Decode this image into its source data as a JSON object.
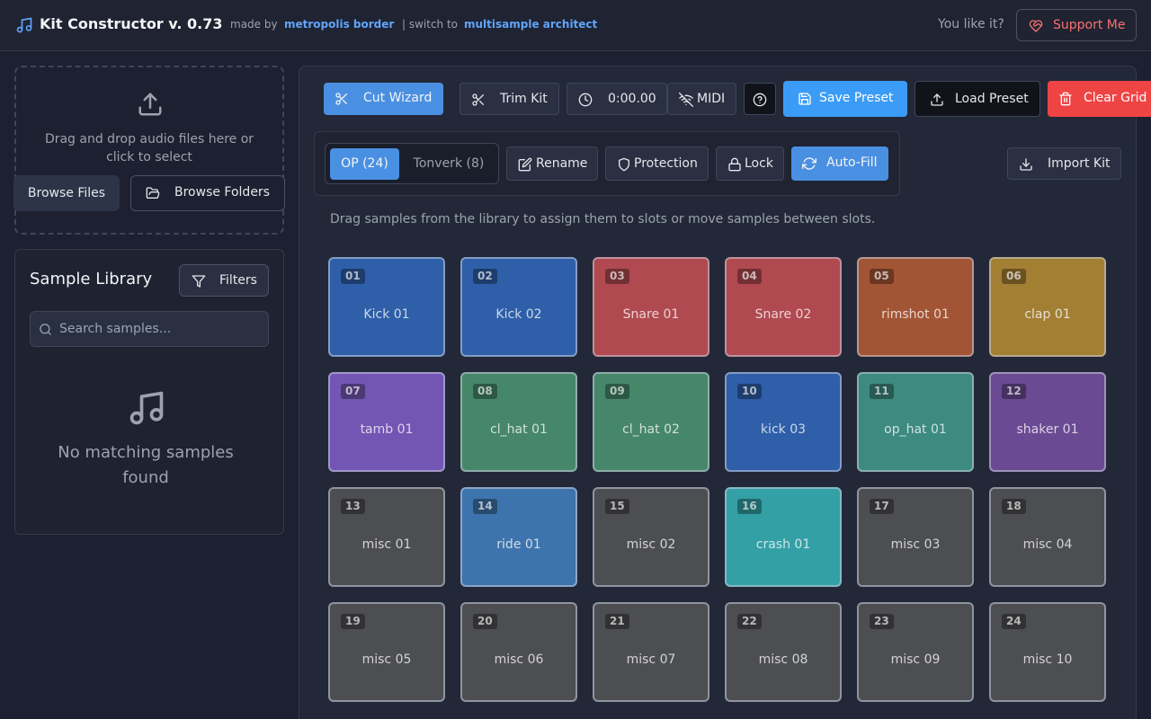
{
  "header": {
    "title": "Kit Constructor v. 0.73",
    "made_by": "made by",
    "author": "metropolis border",
    "switch_to": "| switch to",
    "switch_link": "multisample architect",
    "you_like": "You like it?",
    "support_label": "Support Me"
  },
  "upload": {
    "text": "Drag and drop audio files here or click to select",
    "browse_files": "Browse Files",
    "browse_folders": "Browse Folders"
  },
  "library": {
    "title": "Sample Library",
    "filters_label": "Filters",
    "search_placeholder": "Search samples...",
    "empty_text": "No matching samples found"
  },
  "toolbar": {
    "cut_wizard": "Cut Wizard",
    "trim_kit": "Trim Kit",
    "time": "0:00.00",
    "midi": "MIDI",
    "save_preset": "Save Preset",
    "load_preset": "Load Preset",
    "clear_grid": "Clear Grid"
  },
  "tools": {
    "tab_op": "OP (24)",
    "tab_tonverk": "Tonverk (8)",
    "rename": "Rename",
    "protection": "Protection",
    "lock": "Lock",
    "auto_fill": "Auto-Fill",
    "import_kit": "Import Kit"
  },
  "hint": "Drag samples from the library to assign them to slots or move samples between slots.",
  "pads": [
    {
      "num": "01",
      "name": "Kick 01",
      "color": "#2e5fa8"
    },
    {
      "num": "02",
      "name": "Kick 02",
      "color": "#2e5fa8"
    },
    {
      "num": "03",
      "name": "Snare 01",
      "color": "#b04a50"
    },
    {
      "num": "04",
      "name": "Snare 02",
      "color": "#b04a50"
    },
    {
      "num": "05",
      "name": "rimshot 01",
      "color": "#a25535"
    },
    {
      "num": "06",
      "name": "clap 01",
      "color": "#a37f34"
    },
    {
      "num": "07",
      "name": "tamb 01",
      "color": "#7356b3"
    },
    {
      "num": "08",
      "name": "cl_hat 01",
      "color": "#46876a"
    },
    {
      "num": "09",
      "name": "cl_hat 02",
      "color": "#46876a"
    },
    {
      "num": "10",
      "name": "kick 03",
      "color": "#2e5fa8"
    },
    {
      "num": "11",
      "name": "op_hat 01",
      "color": "#3c8a80"
    },
    {
      "num": "12",
      "name": "shaker 01",
      "color": "#6a4a92"
    },
    {
      "num": "13",
      "name": "misc 01",
      "color": "#4d4e52"
    },
    {
      "num": "14",
      "name": "ride 01",
      "color": "#3e74ad"
    },
    {
      "num": "15",
      "name": "misc 02",
      "color": "#4d4e52"
    },
    {
      "num": "16",
      "name": "crash 01",
      "color": "#33a0a6"
    },
    {
      "num": "17",
      "name": "misc 03",
      "color": "#4d4e52"
    },
    {
      "num": "18",
      "name": "misc 04",
      "color": "#4d4e52"
    },
    {
      "num": "19",
      "name": "misc 05",
      "color": "#4d4e52"
    },
    {
      "num": "20",
      "name": "misc 06",
      "color": "#4d4e52"
    },
    {
      "num": "21",
      "name": "misc 07",
      "color": "#4d4e52"
    },
    {
      "num": "22",
      "name": "misc 08",
      "color": "#4d4e52"
    },
    {
      "num": "23",
      "name": "misc 09",
      "color": "#4d4e52"
    },
    {
      "num": "24",
      "name": "misc 10",
      "color": "#4d4e52"
    }
  ]
}
